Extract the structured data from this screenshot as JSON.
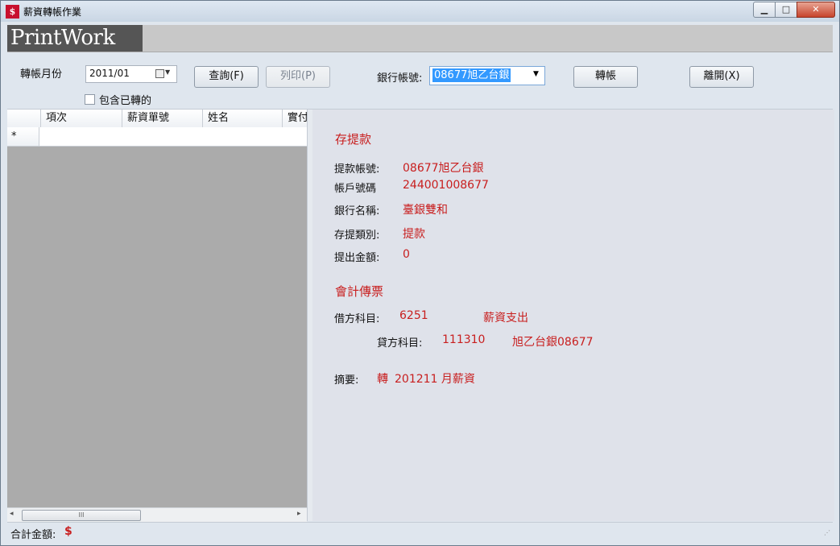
{
  "window": {
    "title": "薪資轉帳作業",
    "icon_glyph": "$",
    "controls": {
      "min": "▁",
      "max": "□",
      "close": "✕"
    }
  },
  "banner": {
    "logo": "PrintWork"
  },
  "toolbar": {
    "month_label": "轉帳月份",
    "month_value": "2011/01",
    "query_label": "查詢(F)",
    "print_label": "列印(P)",
    "include_label": "包含已轉的",
    "include_checked": false,
    "bank_label": "銀行帳號:",
    "bank_value": "08677旭乙台銀",
    "transfer_label": "轉帳",
    "exit_label": "離開(X)"
  },
  "grid": {
    "columns": [
      "項次",
      "薪資單號",
      "姓名",
      "實付"
    ],
    "new_row_marker": "*",
    "rows": []
  },
  "scroll": {
    "left": "◂",
    "right": "▸",
    "thumb": "III"
  },
  "detail": {
    "deposit": {
      "title": "存提款",
      "withdraw_account_label": "提款帳號:",
      "withdraw_account_value": "08677旭乙台銀",
      "account_no_label": "帳戶號碼",
      "account_no_value": "244001008677",
      "bank_name_label": "銀行名稱:",
      "bank_name_value": "臺銀雙和",
      "type_label": "存提類別:",
      "type_value": "提款",
      "amount_label": "提出金額:",
      "amount_value": "0"
    },
    "voucher": {
      "title": "會計傳票",
      "debit_label": "借方科目:",
      "debit_code": "6251",
      "debit_name": "薪資支出",
      "credit_label": "貸方科目:",
      "credit_code": "111310",
      "credit_name": "旭乙台銀08677",
      "summary_label": "摘要:",
      "summary_prefix": "轉",
      "summary_value": "201211 月薪資"
    }
  },
  "status": {
    "total_label": "合計金額:",
    "total_symbol": "$",
    "grip": "⋰"
  },
  "colors": {
    "accent_red": "#c81e1e",
    "selection": "#3399ff",
    "grid_bg": "#ababab"
  }
}
